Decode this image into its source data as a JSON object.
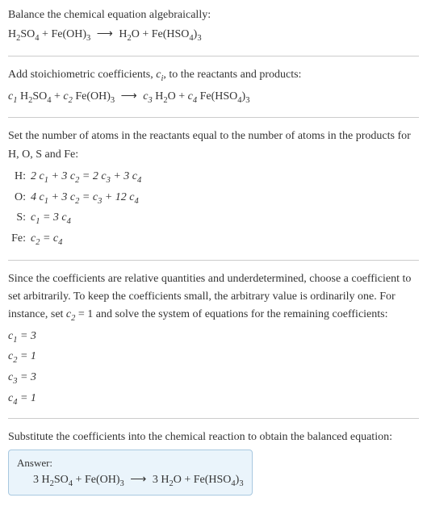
{
  "title": "Balance the chemical equation algebraically:",
  "eq1_lhs1": "H",
  "eq1_lhs1_sub1": "2",
  "eq1_lhs1_mid": "SO",
  "eq1_lhs1_sub2": "4",
  "plus": " + ",
  "eq1_lhs2": "Fe(OH)",
  "eq1_lhs2_sub": "3",
  "arrow": "⟶",
  "eq1_rhs1": "H",
  "eq1_rhs1_sub": "2",
  "eq1_rhs1_o": "O",
  "eq1_rhs2": "Fe(HSO",
  "eq1_rhs2_sub1": "4",
  "eq1_rhs2_close": ")",
  "eq1_rhs2_sub2": "3",
  "step2_text": "Add stoichiometric coefficients, ",
  "step2_ci_c": "c",
  "step2_ci_i": "i",
  "step2_text2": ", to the reactants and products:",
  "c1": "c",
  "sub1": "1",
  "c2": "c",
  "sub2": "2",
  "c3": "c",
  "sub3": "3",
  "c4": "c",
  "sub4": "4",
  "step3_text": "Set the number of atoms in the reactants equal to the number of atoms in the products for H, O, S and Fe:",
  "atoms": {
    "H": {
      "label": "H:",
      "eq": "2 c₁ + 3 c₂ = 2 c₃ + 3 c₄"
    },
    "O": {
      "label": "O:",
      "eq": "4 c₁ + 3 c₂ = c₃ + 12 c₄"
    },
    "S": {
      "label": "S:",
      "eq": "c₁ = 3 c₄"
    },
    "Fe": {
      "label": "Fe:",
      "eq": "c₂ = c₄"
    }
  },
  "step4_text1": "Since the coefficients are relative quantities and underdetermined, choose a coefficient to set arbitrarily. To keep the coefficients small, the arbitrary value is ordinarily one. For instance, set ",
  "step4_c2": "c",
  "step4_c2sub": "2",
  "step4_text2": " = 1 and solve the system of equations for the remaining coefficients:",
  "coeffs": {
    "c1": "c₁ = 3",
    "c2": "c₂ = 1",
    "c3": "c₃ = 3",
    "c4": "c₄ = 1"
  },
  "step5_text": "Substitute the coefficients into the chemical reaction to obtain the balanced equation:",
  "answer_label": "Answer:",
  "answer_3a": "3 H",
  "answer_3b": "3 H",
  "chart_data": {
    "type": "table",
    "title": "Balanced chemical equation coefficients",
    "reactants": [
      {
        "species": "H2SO4",
        "coefficient": 3
      },
      {
        "species": "Fe(OH)3",
        "coefficient": 1
      }
    ],
    "products": [
      {
        "species": "H2O",
        "coefficient": 3
      },
      {
        "species": "Fe(HSO4)3",
        "coefficient": 1
      }
    ],
    "atom_balance": [
      {
        "element": "H",
        "equation": "2c1 + 3c2 = 2c3 + 3c4"
      },
      {
        "element": "O",
        "equation": "4c1 + 3c2 = c3 + 12c4"
      },
      {
        "element": "S",
        "equation": "c1 = 3c4"
      },
      {
        "element": "Fe",
        "equation": "c2 = c4"
      }
    ],
    "solution": {
      "c1": 3,
      "c2": 1,
      "c3": 3,
      "c4": 1
    }
  }
}
